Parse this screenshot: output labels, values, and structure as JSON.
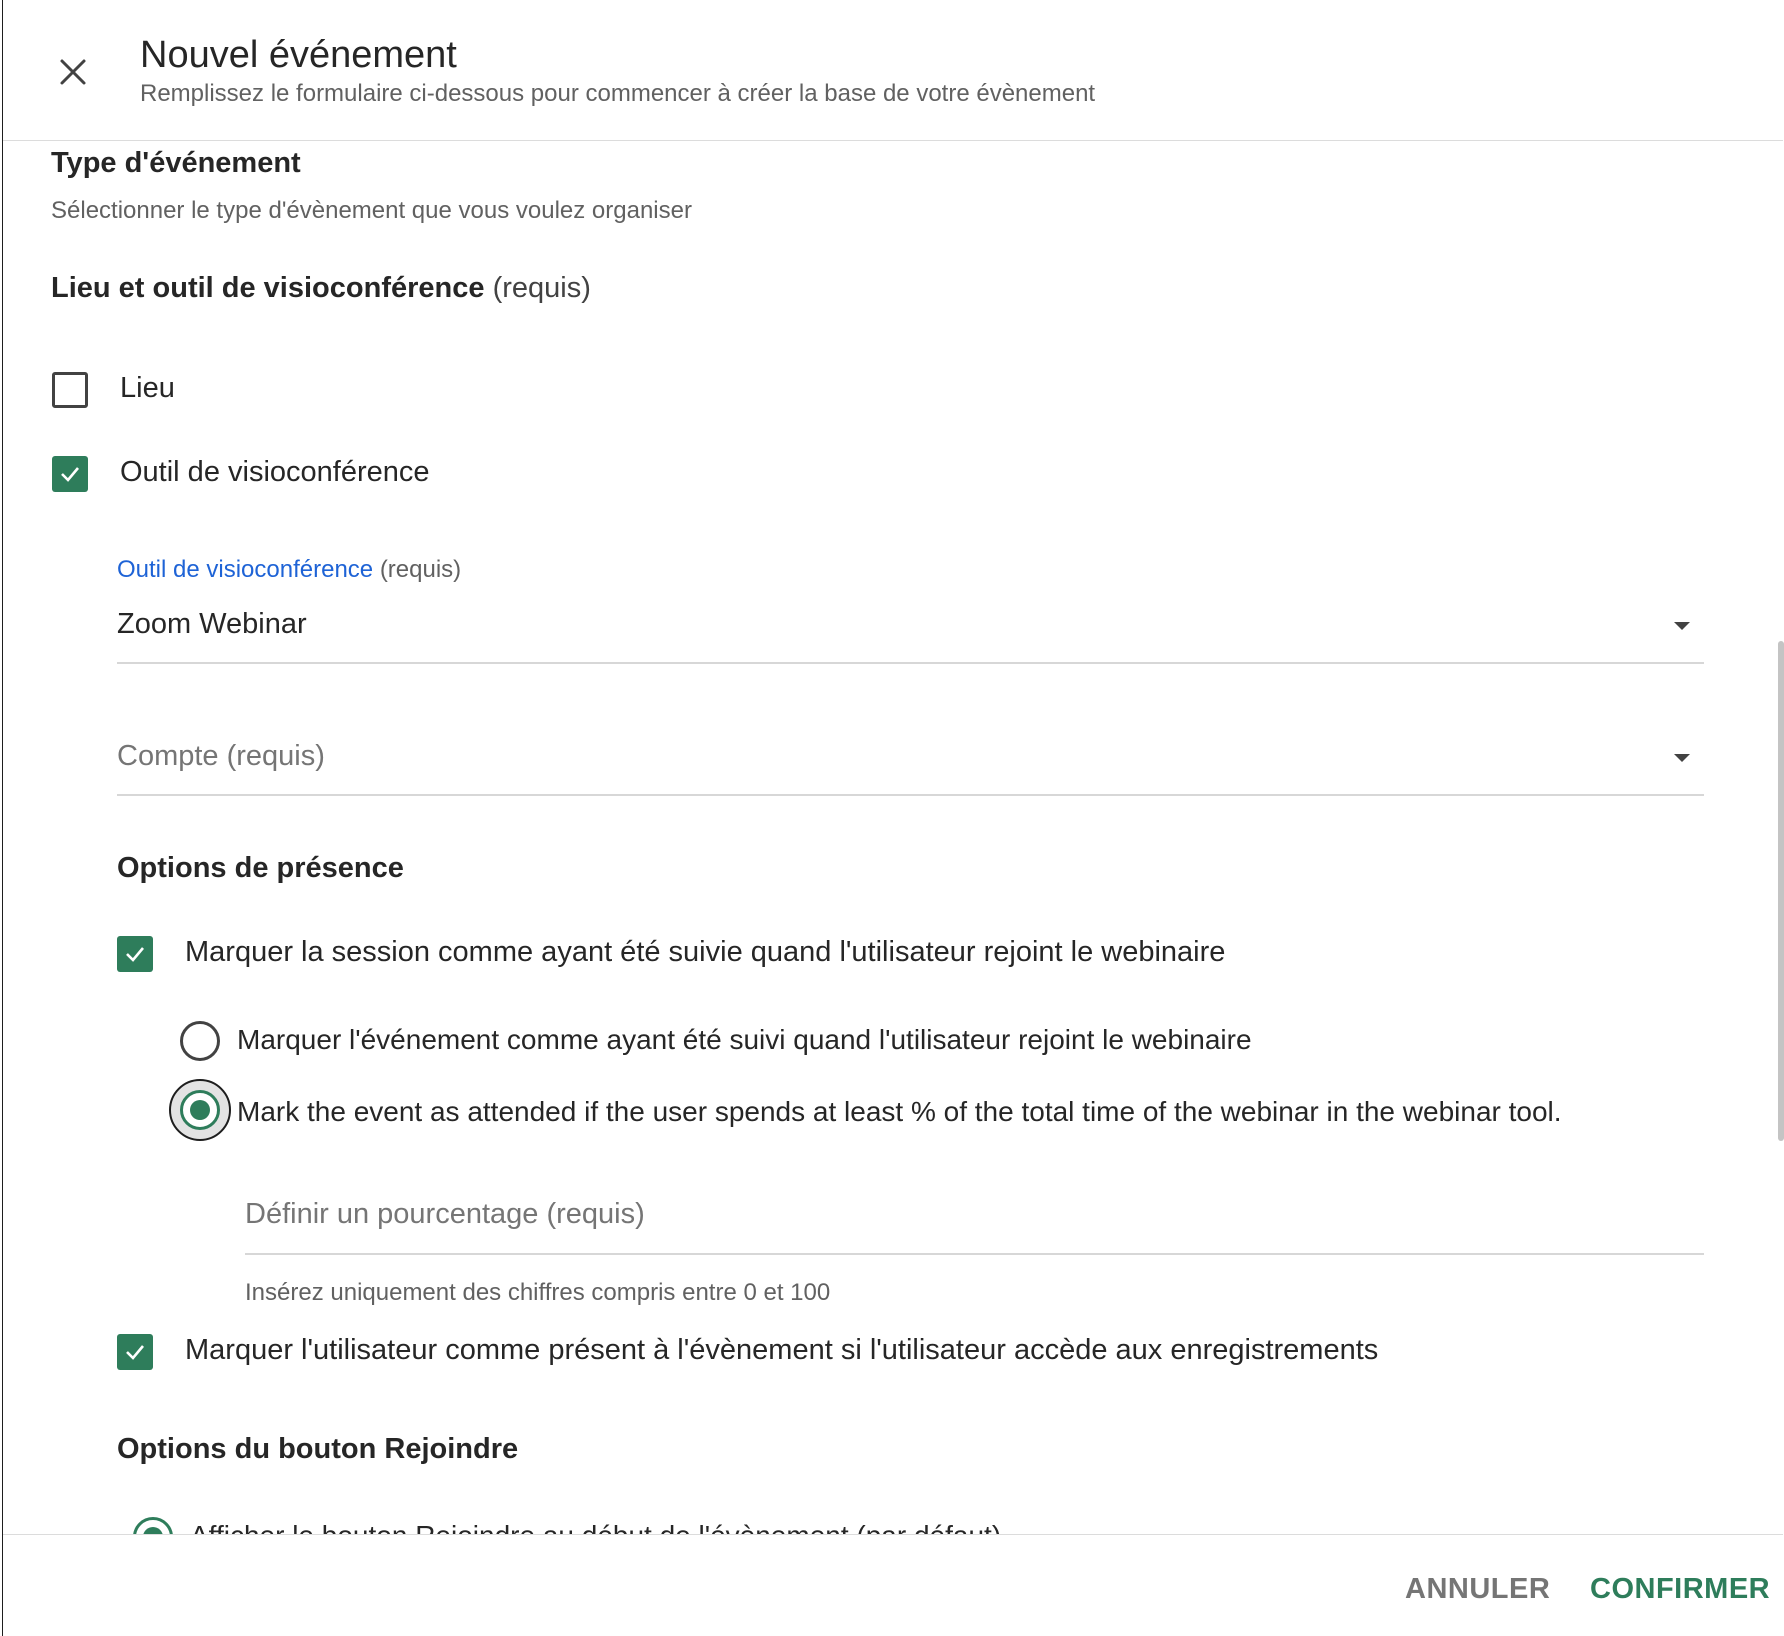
{
  "header": {
    "title": "Nouvel événement",
    "subtitle": "Remplissez le formulaire ci-dessous pour commencer à créer la base de votre évènement"
  },
  "event_type": {
    "title": "Type d'événement",
    "description": "Sélectionner le type d'évènement que vous voulez organiser"
  },
  "location": {
    "title": "Lieu et outil de visioconférence",
    "required": "(requis)",
    "options": [
      {
        "label": "Lieu",
        "checked": false
      },
      {
        "label": "Outil de visioconférence",
        "checked": true
      }
    ]
  },
  "video_tool": {
    "label": "Outil de visioconférence",
    "required": "(requis)",
    "value": "Zoom Webinar"
  },
  "account": {
    "placeholder": "Compte (requis)"
  },
  "presence": {
    "title": "Options de présence",
    "session_attended_label": "Marquer la session comme ayant été suivie quand l'utilisateur rejoint le webinaire",
    "session_attended_checked": true,
    "radio_join_label": "Marquer l'événement comme ayant été suivi quand l'utilisateur rejoint le webinaire",
    "radio_join_selected": false,
    "radio_time_label": "Mark the event as attended if the user spends at least % of the total time of the webinar in the webinar tool.",
    "radio_time_selected": true,
    "percentage_placeholder": "Définir un pourcentage  (requis)",
    "percentage_hint": "Insérez uniquement des chiffres compris entre 0 et 100",
    "recordings_label": "Marquer l'utilisateur comme présent à l'évènement si l'utilisateur accède aux enregistrements",
    "recordings_checked": true
  },
  "join_button": {
    "title": "Options du bouton Rejoindre",
    "first_option_label": "Afficher le bouton Rejoindre au début de l'évènement (par défaut)"
  },
  "footer": {
    "cancel_label": "ANNULER",
    "confirm_label": "CONFIRMER"
  },
  "colors": {
    "accent_green": "#2e7d5b",
    "link_blue": "#1e63d6"
  }
}
